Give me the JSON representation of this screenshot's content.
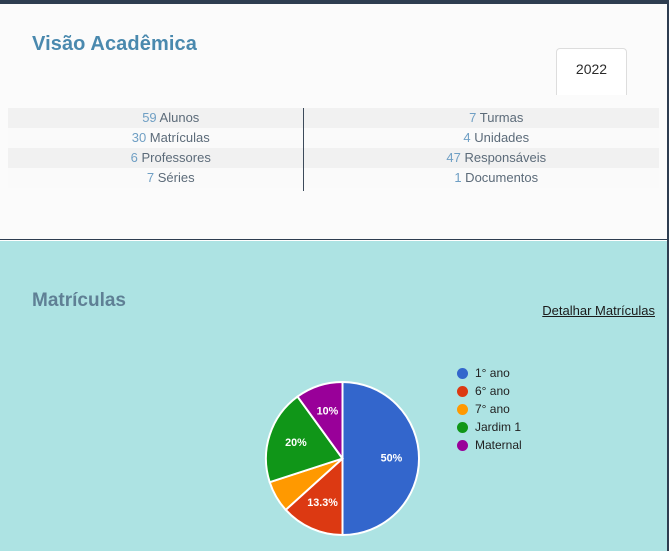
{
  "window": {
    "chrome_color": "#2e3d50"
  },
  "academic": {
    "title": "Visão Acadêmica",
    "year_tab": {
      "label": "2022",
      "name": "year-tab-2022"
    },
    "stats_rows": [
      {
        "left": {
          "value": "59",
          "label": "Alunos"
        },
        "right": {
          "value": "7",
          "label": "Turmas"
        }
      },
      {
        "left": {
          "value": "30",
          "label": "Matrículas"
        },
        "right": {
          "value": "4",
          "label": "Unidades"
        }
      },
      {
        "left": {
          "value": "6",
          "label": "Professores"
        },
        "right": {
          "value": "47",
          "label": "Responsáveis"
        }
      },
      {
        "left": {
          "value": "7",
          "label": "Séries"
        },
        "right": {
          "value": "1",
          "label": "Documentos"
        }
      }
    ]
  },
  "enrollment": {
    "title": "Matrículas",
    "detail_link": "Detalhar Matrículas",
    "panel_color": "#ade3e3"
  },
  "chart_data": {
    "type": "pie",
    "title": "Matrículas",
    "categories": [
      "1° ano",
      "6° ano",
      "7° ano",
      "Jardim 1",
      "Maternal"
    ],
    "values": [
      50,
      13.3,
      6.7,
      20,
      10
    ],
    "value_labels": [
      "50%",
      "13.3%",
      "",
      "20%",
      "10%"
    ],
    "colors": [
      "#3366cc",
      "#dc3912",
      "#ff9900",
      "#109618",
      "#990099"
    ],
    "legend_position": "right",
    "start_angle": 0,
    "direction": "clockwise",
    "slice_border_color": "#ffffff"
  }
}
